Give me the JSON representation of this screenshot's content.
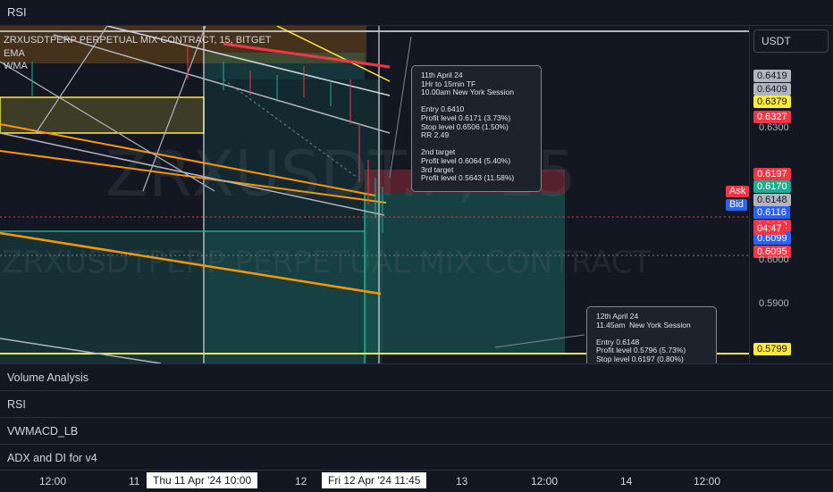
{
  "top_panel": {
    "label": "RSI"
  },
  "symbol_line": "ZRXUSDTPERP PERPETUAL MIX CONTRACT, 15, BITGET",
  "indicators": [
    "EMA",
    "WMA"
  ],
  "watermark": {
    "ticker": "ZRXUSDT.P, 15",
    "name": "ZRXUSDTPERP PERPETUAL MIX CONTRACT"
  },
  "currency_button": "USDT",
  "notes": [
    {
      "text": "11th April 24\n1Hr to 15min TF\n10.00am New York Session\n\nEntry 0.6410\nProfit level 0.6171 (3.73%)\nStop level 0.6506 (1.50%)\nRR 2.49\n\n2nd target\nProfit level 0.6064 (5.40%)\n3rd target\nProfit level 0.5643 (11.58%)"
    },
    {
      "text": "12th April 24\n11.45am  New York Session\n\nEntry 0.6148\nProfit level 0.5796 (5.73%)\nStop level 0.6197 (0.80%)"
    }
  ],
  "price_labels": [
    {
      "text": "0.6419",
      "bg": "#b2b5be",
      "fg": "#131722",
      "y": 0.6419
    },
    {
      "text": "0.6409",
      "bg": "#b2b5be",
      "fg": "#131722",
      "y": 0.6409
    },
    {
      "text": "0.6379",
      "bg": "#ffeb3b",
      "fg": "#131722",
      "y": 0.6379
    },
    {
      "text": "0.6327",
      "bg": "#f23645",
      "fg": "#ffffff",
      "y": 0.6327
    },
    {
      "text": "0.6197",
      "bg": "#f23645",
      "fg": "#ffffff",
      "y": 0.6197
    },
    {
      "text": "0.6170",
      "bg": "#22ab94",
      "fg": "#ffffff",
      "y": 0.617
    },
    {
      "text": "0.6148",
      "bg": "#b2b5be",
      "fg": "#131722",
      "y": 0.6148
    },
    {
      "text": "0.6116",
      "bg": "#2962ff",
      "fg": "#ffffff",
      "y": 0.6116
    },
    {
      "text": "0.6102",
      "bg": "#f23645",
      "fg": "#ffffff",
      "y": 0.6102
    },
    {
      "text": "0.6099",
      "bg": "#2962ff",
      "fg": "#ffffff",
      "y": 0.6099
    },
    {
      "text": "0.6095",
      "bg": "#f23645",
      "fg": "#ffffff",
      "y": 0.6095
    },
    {
      "text": "0.5799",
      "bg": "#ffeb3b",
      "fg": "#131722",
      "y": 0.5799
    }
  ],
  "countdown": "04:47",
  "ask_label": "Ask",
  "bid_label": "Bid",
  "price_ticks": [
    {
      "text": "0.6300",
      "y": 0.63
    },
    {
      "text": "0.6000",
      "y": 0.6
    },
    {
      "text": "0.5900",
      "y": 0.59
    }
  ],
  "panes": [
    "Volume Analysis",
    "RSI",
    "VWMACD_LB",
    "ADX and DI for v4"
  ],
  "time_labels": [
    "12:00",
    "11",
    "12",
    "13",
    "12:00",
    "14",
    "12:00"
  ],
  "time_highlights": [
    "Thu 11 Apr '24   10:00",
    "Fri 12 Apr '24   11:45"
  ],
  "colors": {
    "background": "#131722",
    "long_zone": "#22ab94",
    "short_zone": "#f23645",
    "trend_orange": "#ff9800",
    "level_yellow": "#ffeb3b"
  }
}
